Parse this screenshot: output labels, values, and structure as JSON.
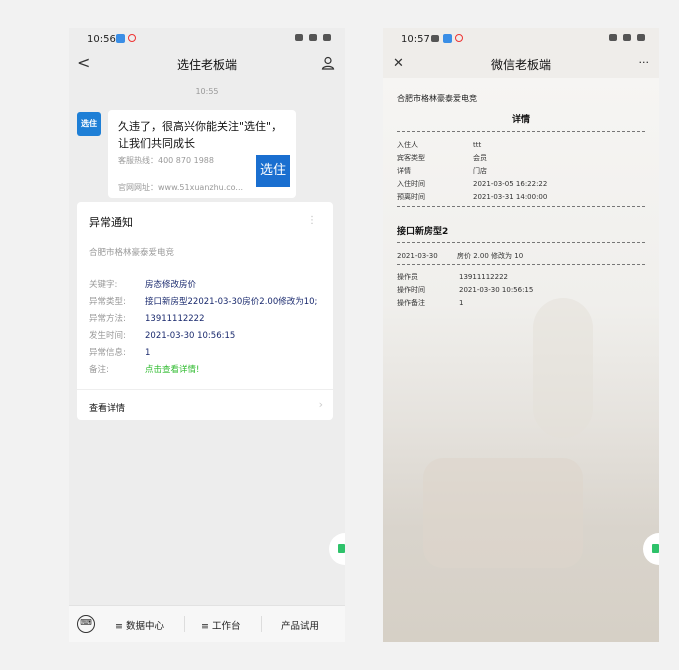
{
  "phone1": {
    "status_time": "10:56",
    "nav_back": "<",
    "nav_title": "选住老板端",
    "timestamp": "10:55",
    "avatar_text": "选住",
    "bubble": {
      "text": "久违了，很高兴你能关注\"选住\"，让我们共同成长",
      "hotline": "客服热线：400 870 1988",
      "site": "官网网址：www.51xuanzhu.co...",
      "logo_text": "选住"
    },
    "card": {
      "title": "异常通知",
      "more": "⋮",
      "subtitle": "合肥市格林豪泰爱电竞",
      "fields": [
        {
          "label": "关键字:",
          "value": "房态修改房价"
        },
        {
          "label": "异常类型:",
          "value": "接口新房型22021-03-30房价2.00修改为10;"
        },
        {
          "label": "异常方法:",
          "value": "13911112222"
        },
        {
          "label": "发生时间:",
          "value": "2021-03-30 10:56:15"
        },
        {
          "label": "异常信息:",
          "value": "1"
        },
        {
          "label": "备注:",
          "value": "点击查看详情!"
        }
      ],
      "link": "查看详情",
      "link_arrow": "›"
    },
    "bottom": {
      "keyboard_icon": "⌨",
      "items": [
        "≡ 数据中心",
        "≡ 工作台",
        "产品试用"
      ]
    }
  },
  "phone2": {
    "status_time": "10:57",
    "nav_close": "✕",
    "nav_title": "微信老板端",
    "nav_more": "···",
    "doc": {
      "company": "合肥市格林豪泰爱电竞",
      "heading": "详情",
      "rows": [
        {
          "key": "入住人",
          "value": "ttt"
        },
        {
          "key": "宾客类型",
          "value": "会员"
        },
        {
          "key": "详情",
          "value": "门店"
        },
        {
          "key": "入住时间",
          "value": "2021-03-05 16:22:22"
        },
        {
          "key": "预离时间",
          "value": "2021-03-31 14:00:00"
        }
      ],
      "room": "接口新房型2",
      "change_date": "2021-03-30",
      "change_text": "房价 2.00 修改为 10",
      "ops": [
        {
          "key": "操作员",
          "value": "13911112222"
        },
        {
          "key": "操作时间",
          "value": "2021-03-30 10:56:15"
        },
        {
          "key": "操作备注",
          "value": "1"
        }
      ]
    }
  },
  "colors": {
    "accent_blue": "#1a6fd0",
    "value_navy": "#1a2a6e",
    "note_green": "#2fbb2f",
    "float_green": "#2ec26a"
  }
}
